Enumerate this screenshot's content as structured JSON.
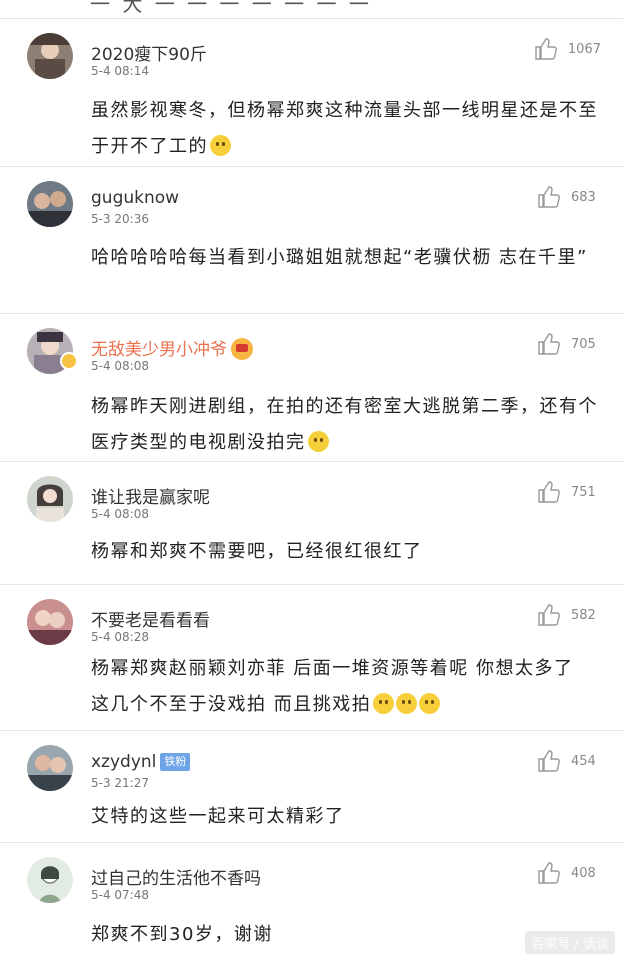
{
  "top_fragment": "一 大 一 一 一 一 一 一 一",
  "comments": [
    {
      "username": "2020瘦下90斤",
      "timestamp": "5-4 08:14",
      "likes": "1067",
      "text": "虽然影视寒冬，但杨幂郑爽这种流量头部一线明星还是不至于开不了工的",
      "emoji": "laugh-emoji"
    },
    {
      "username": "guguknow",
      "timestamp": "5-3 20:36",
      "likes": "683",
      "text": "哈哈哈哈哈每当看到小璐姐姐就想起“老骥伏枥 志在千里”"
    },
    {
      "username": "无敌美少男小冲爷",
      "timestamp": "5-4 08:08",
      "likes": "705",
      "text": "杨幂昨天刚进剧组，在拍的还有密室大逃脱第二季，还有个医疗类型的电视剧没拍完",
      "emoji": "yum-emoji",
      "badge_icon": "crown-icon",
      "verified": true
    },
    {
      "username": "谁让我是赢家呢",
      "timestamp": "5-4 08:08",
      "likes": "751",
      "text": "杨幂和郑爽不需要吧，已经很红很红了"
    },
    {
      "username": "不要老是看看看",
      "timestamp": "5-4 08:28",
      "likes": "582",
      "text_line1": "杨幂郑爽赵丽颖刘亦菲 后面一堆资源等着呢 你想太多了",
      "text_line2": "这几个不至于没戏拍 而且挑戏拍",
      "emoji": "cat-emoji"
    },
    {
      "username": "xzydynl",
      "timestamp": "5-3 21:27",
      "likes": "454",
      "fans_badge": "铁粉",
      "text": "艾特的这些一起来可太精彩了"
    },
    {
      "username": "过自己的生活他不香吗",
      "timestamp": "5-4 07:48",
      "likes": "408",
      "text": "郑爽不到30岁，谢谢"
    }
  ],
  "watermark": "百家号 / 谈谈",
  "colors": {
    "vip_name": "#eb7350",
    "fans_badge": "#6ea3e6",
    "like_icon": "#9a9a9a"
  }
}
